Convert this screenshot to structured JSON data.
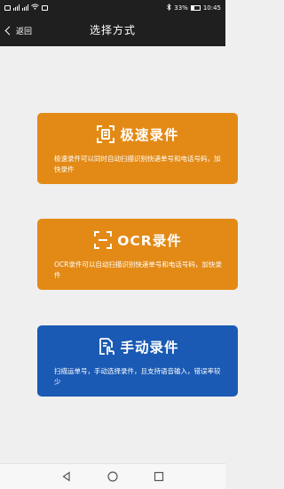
{
  "status_bar": {
    "battery": "33%",
    "time": "10:45",
    "icons": [
      "sim-icon",
      "signal-icon",
      "wifi-icon",
      "bluetooth-icon",
      "battery-icon"
    ]
  },
  "header": {
    "back_label": "返回",
    "title": "选择方式"
  },
  "cards": [
    {
      "title": "极速录件",
      "description": "极速录件可以同时自动扫描识别快递单号和电话号码，加快录件",
      "icon": "scan-frame-icon",
      "color": "#e38a16"
    },
    {
      "title": "OCR录件",
      "description": "OCR录件可以自动扫描识别快递单号和电话号码，加快录件",
      "icon": "ocr-scan-icon",
      "color": "#e38a16"
    },
    {
      "title": "手动录件",
      "description": "扫描运单号，手动选择录件，且支持语音输入，错误率较少",
      "icon": "touch-document-icon",
      "color": "#1a5ab4"
    }
  ],
  "nav": [
    "back-triangle-icon",
    "home-circle-icon",
    "recent-square-icon"
  ]
}
